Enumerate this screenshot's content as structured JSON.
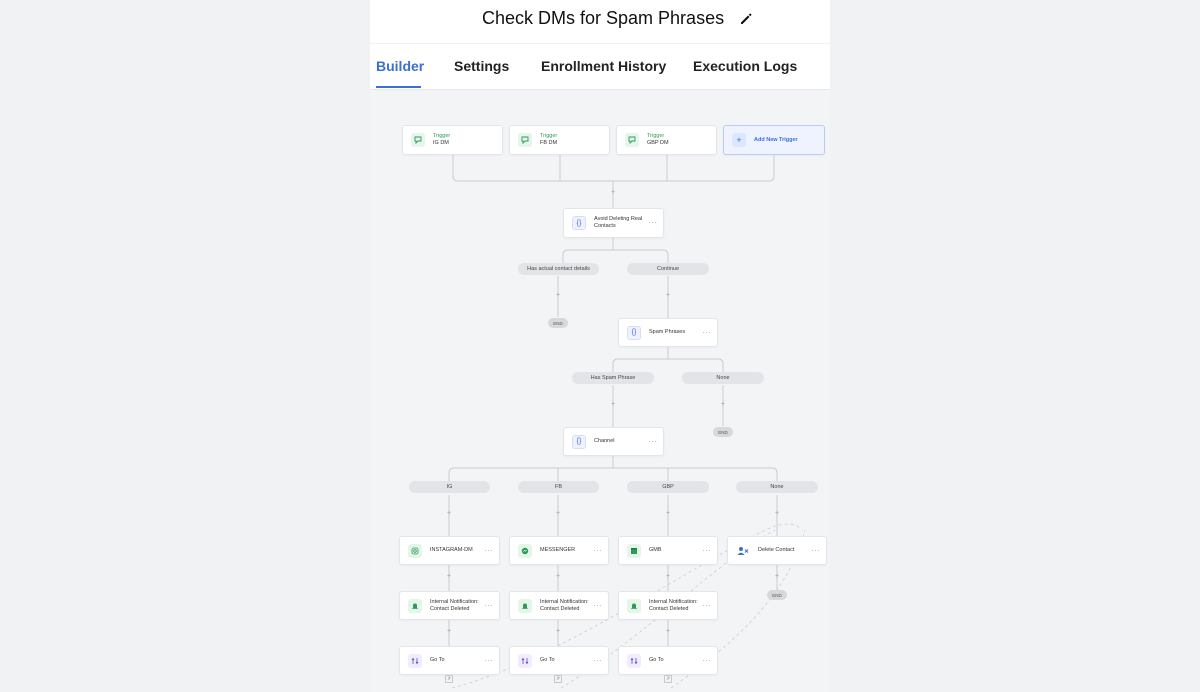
{
  "header": {
    "title": "Check DMs for Spam Phrases",
    "edit_icon": "pencil-icon"
  },
  "tabs": [
    {
      "label": "Builder",
      "active": true
    },
    {
      "label": "Settings",
      "active": false
    },
    {
      "label": "Enrollment History",
      "active": false
    },
    {
      "label": "Execution Logs",
      "active": false
    }
  ],
  "triggers": [
    {
      "type": "Trigger",
      "name": "IG DM",
      "icon": "chat-bubble-icon"
    },
    {
      "type": "Trigger",
      "name": "FB DM",
      "icon": "chat-bubble-icon"
    },
    {
      "type": "Trigger",
      "name": "GBP DM",
      "icon": "chat-bubble-icon"
    }
  ],
  "add_trigger": {
    "label": "Add New Trigger",
    "icon": "plus-icon"
  },
  "steps": {
    "avoid_deleting": {
      "label_line1": "Avoid Deleting Real",
      "label_line2": "Contacts",
      "icon": "code-braces-icon"
    },
    "spam_phrases": {
      "label": "Spam Phrases",
      "icon": "code-braces-icon"
    },
    "channel": {
      "label": "Channel",
      "icon": "code-braces-icon"
    },
    "instagram": {
      "label": "INSTAGRAM-DM",
      "icon": "instagram-icon"
    },
    "messenger": {
      "label": "MESSENGER",
      "icon": "messenger-icon"
    },
    "gmb": {
      "label": "GMB",
      "icon": "gmb-icon"
    },
    "delete_contact": {
      "label": "Delete Contact",
      "icon": "delete-user-icon"
    },
    "notif_ig": {
      "label_line1": "Internal Notification:",
      "label_line2": "Contact Deleted",
      "icon": "bell-icon"
    },
    "notif_fb": {
      "label_line1": "Internal Notification:",
      "label_line2": "Contact Deleted",
      "icon": "bell-icon"
    },
    "notif_gbp": {
      "label_line1": "Internal Notification:",
      "label_line2": "Contact Deleted",
      "icon": "bell-icon"
    },
    "goto_ig": {
      "label": "Go To",
      "icon": "goto-icon"
    },
    "goto_fb": {
      "label": "Go To",
      "icon": "goto-icon"
    },
    "goto_gbp": {
      "label": "Go To",
      "icon": "goto-icon"
    }
  },
  "branches": {
    "has_contact": "Has actual contact details",
    "continue": "Continue",
    "has_spam": "Has Spam Phrase",
    "none_spam": "None",
    "ig": "IG",
    "fb": "FB",
    "gbp": "GBP",
    "none_channel": "None"
  },
  "end_label": "END",
  "menu_dots": "···",
  "plus_symbol": "+"
}
